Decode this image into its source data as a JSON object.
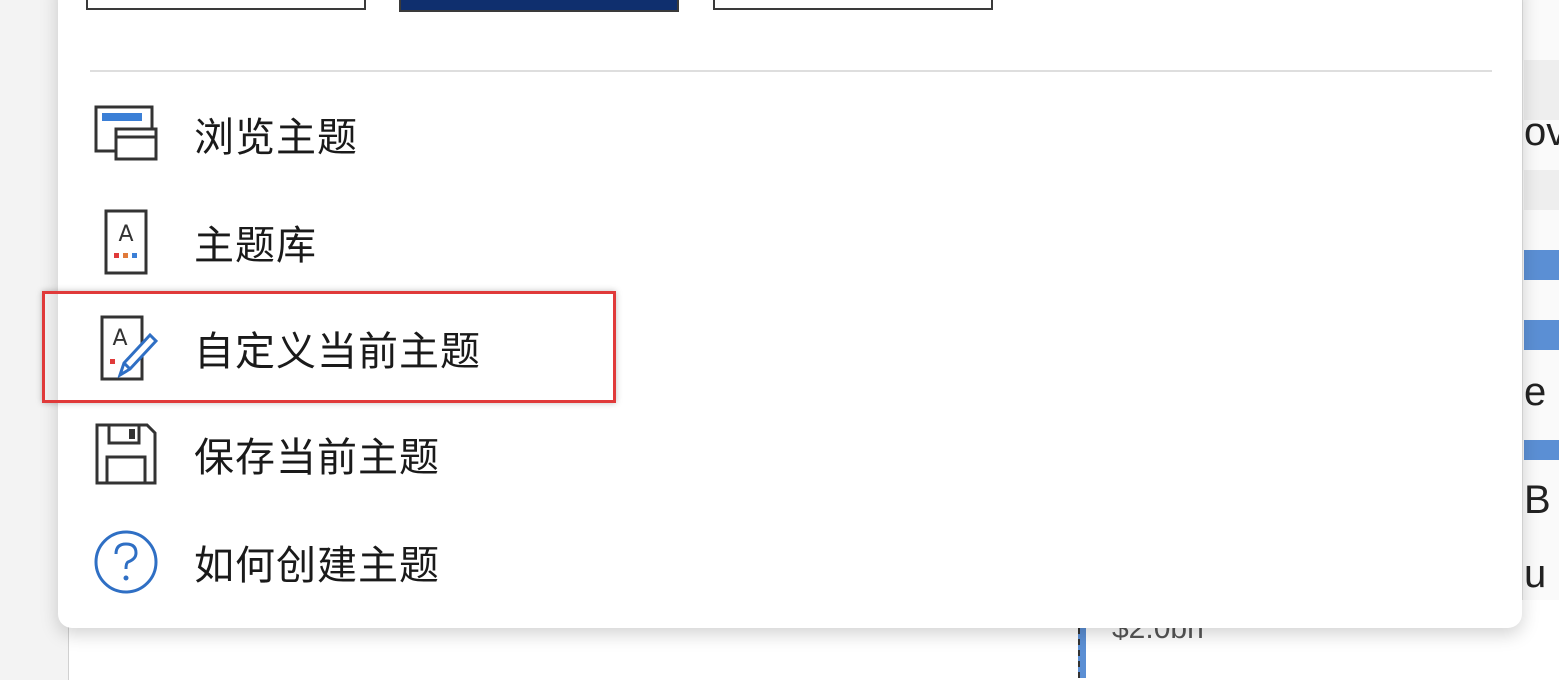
{
  "background": {
    "money_label": "$2.0bn",
    "right_fragments": [
      "ov",
      "e",
      "B",
      "u"
    ]
  },
  "palettes": [
    {
      "name": "palette-1",
      "colors": [
        "#1f2d7a",
        "#2f4fa8",
        "#2f8fd0",
        "#4bbad8",
        "#f5b2c4",
        "#ea4b4f",
        "#c22b3a",
        "#8f1f2a"
      ]
    },
    {
      "name": "palette-2",
      "colors": [
        "#1d4e9e",
        "#2b7bd6",
        "#3d92e6",
        "#6eb4ef",
        "#3a8b7a",
        "#3d8a3e",
        "#4a8f3a",
        "#2f6f2f"
      ]
    },
    {
      "name": "palette-3",
      "colors": [
        "#f08020",
        "#1d2f4a",
        "#d7b21a",
        "#444444",
        "#d22a2a",
        "#a8d8dc",
        "#4a7a2a",
        "#3fb8b8"
      ]
    }
  ],
  "menu": {
    "items": [
      {
        "label": "浏览主题",
        "icon": "browse-themes-icon"
      },
      {
        "label": "主题库",
        "icon": "theme-gallery-icon"
      },
      {
        "label": "自定义当前主题",
        "icon": "customize-theme-icon"
      },
      {
        "label": "保存当前主题",
        "icon": "save-icon"
      },
      {
        "label": "如何创建主题",
        "icon": "help-icon"
      }
    ],
    "highlighted_index": 2,
    "highlight_color": "#e03a3a"
  }
}
